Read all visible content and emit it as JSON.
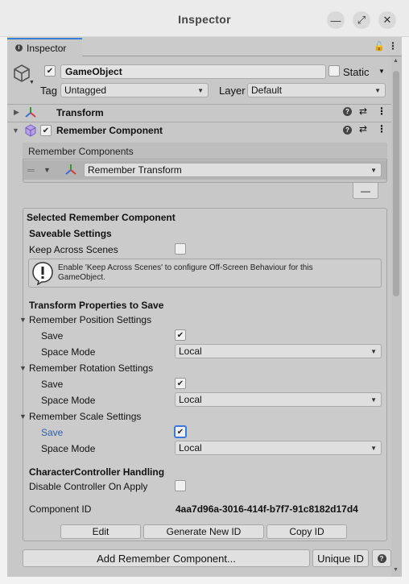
{
  "window": {
    "title": "Inspector",
    "minimize": "—",
    "maximize": "⤢",
    "close": "✕"
  },
  "tab": {
    "label": "Inspector"
  },
  "gameobject": {
    "name": "GameObject",
    "static_label": "Static",
    "tag_label": "Tag",
    "tag_value": "Untagged",
    "layer_label": "Layer",
    "layer_value": "Default"
  },
  "components": {
    "transform": "Transform",
    "remember": "Remember Component"
  },
  "remember_list": {
    "header": "Remember Components",
    "item": "Remember Transform",
    "remove": "—"
  },
  "selected": {
    "title": "Selected Remember Component",
    "saveable_title": "Saveable Settings",
    "keep_across": "Keep Across Scenes",
    "warning": "Enable 'Keep Across Scenes' to configure Off-Screen Behaviour for this GameObject.",
    "transform_title": "Transform Properties to Save",
    "position": "Remember Position Settings",
    "rotation": "Remember Rotation Settings",
    "scale": "Remember Scale Settings",
    "save": "Save",
    "space_mode": "Space Mode",
    "space_value": "Local",
    "cc_title": "CharacterController Handling",
    "disable_controller": "Disable Controller On Apply",
    "component_id_label": "Component ID",
    "component_id": "4aa7d96a-3016-414f-b7f7-91c8182d17d4",
    "edit": "Edit",
    "generate": "Generate New ID",
    "copy": "Copy ID"
  },
  "footer": {
    "add": "Add Remember Component...",
    "unique": "Unique ID",
    "help": "?"
  }
}
